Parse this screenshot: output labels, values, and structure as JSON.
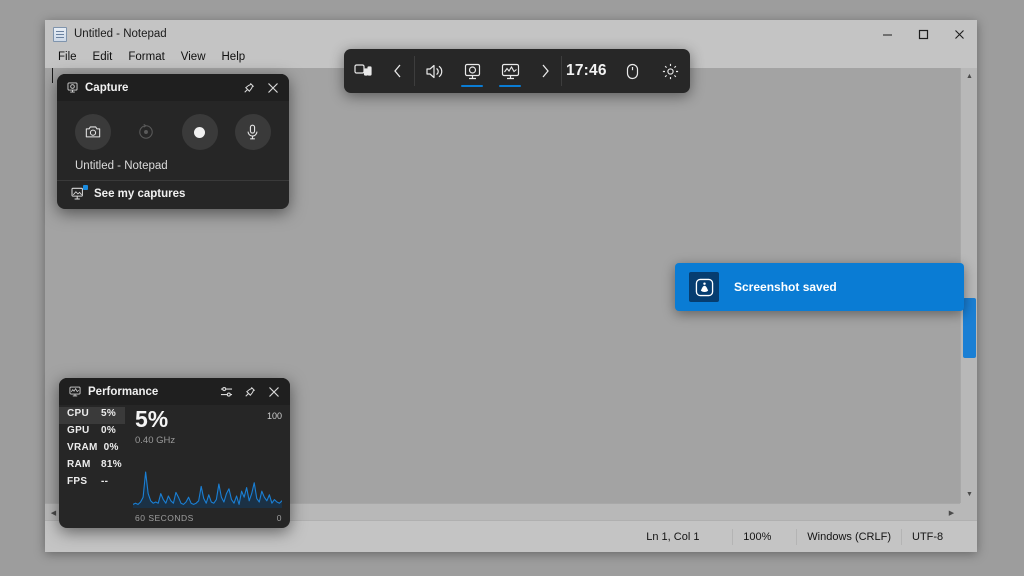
{
  "notepad": {
    "title": "Untitled - Notepad",
    "icon": "notepad-icon",
    "menus": [
      "File",
      "Edit",
      "Format",
      "View",
      "Help"
    ],
    "window_controls": {
      "minimize": "minimize-icon",
      "maximize": "maximize-icon",
      "close": "close-icon"
    },
    "document_text": "",
    "status": {
      "cursor": "Ln 1, Col 1",
      "zoom": "100%",
      "line_ending": "Windows (CRLF)",
      "encoding": "UTF-8"
    }
  },
  "gamebar": {
    "items": [
      {
        "name": "widget-menu",
        "icon": "widgets-icon",
        "underline": false
      },
      {
        "name": "scroll-left",
        "icon": "chevron-left-icon",
        "underline": false
      },
      {
        "name": "audio-widget",
        "icon": "speaker-icon",
        "underline": false
      },
      {
        "name": "capture-widget",
        "icon": "capture-icon",
        "underline": true
      },
      {
        "name": "performance-widget",
        "icon": "performance-icon",
        "underline": true
      },
      {
        "name": "scroll-right",
        "icon": "chevron-right-icon",
        "underline": false
      }
    ],
    "time": "17:46",
    "trailing": [
      {
        "name": "gaming-input",
        "icon": "mouse-icon"
      },
      {
        "name": "settings",
        "icon": "gear-icon"
      }
    ]
  },
  "capture_widget": {
    "title": "Capture",
    "header_icon": "capture-icon",
    "pin_icon": "pin-icon",
    "close_icon": "close-icon",
    "buttons": [
      {
        "name": "take-screenshot",
        "icon": "camera-icon",
        "enabled": true
      },
      {
        "name": "record-last-30-seconds",
        "icon": "record-last-icon",
        "enabled": false
      },
      {
        "name": "start-recording",
        "icon": "record-dot-icon",
        "enabled": true
      },
      {
        "name": "toggle-microphone",
        "icon": "microphone-icon",
        "enabled": true
      }
    ],
    "app_name": "Untitled - Notepad",
    "see_captures_label": "See my captures",
    "see_captures_icon": "gallery-icon"
  },
  "performance_widget": {
    "title": "Performance",
    "header_icon": "performance-icon",
    "settings_icon": "sliders-icon",
    "pin_icon": "pin-icon",
    "close_icon": "close-icon",
    "metrics": [
      {
        "label": "CPU",
        "value": "5%",
        "selected": true
      },
      {
        "label": "GPU",
        "value": "0%",
        "selected": false
      },
      {
        "label": "VRAM",
        "value": "0%",
        "selected": false
      },
      {
        "label": "RAM",
        "value": "81%",
        "selected": false
      },
      {
        "label": "FPS",
        "value": "--",
        "selected": false
      }
    ],
    "primary_value": "5%",
    "secondary_value": "0.40 GHz",
    "chart_max_label": "100",
    "chart_min_label": "0",
    "time_axis_label": "60 SECONDS"
  },
  "toast": {
    "label": "Screenshot saved",
    "icon": "game-bar-icon",
    "accent_color": "#0a7cd4"
  },
  "chart_data": {
    "type": "line",
    "title": "CPU utilization",
    "ylabel": "%",
    "xlabel": "60 SECONDS",
    "ylim": [
      0,
      100
    ],
    "grid": false,
    "legend": false,
    "series": [
      {
        "name": "CPU %",
        "color": "#1a7fd4",
        "values": [
          3,
          4,
          3,
          5,
          9,
          30,
          12,
          6,
          4,
          5,
          4,
          12,
          7,
          4,
          10,
          6,
          4,
          13,
          9,
          4,
          3,
          5,
          9,
          4,
          3,
          4,
          6,
          18,
          8,
          4,
          11,
          5,
          4,
          7,
          20,
          9,
          5,
          12,
          16,
          7,
          4,
          10,
          3,
          14,
          9,
          17,
          6,
          12,
          21,
          8,
          5,
          14,
          9,
          6,
          11,
          4,
          7,
          5,
          4,
          6
        ]
      }
    ]
  }
}
